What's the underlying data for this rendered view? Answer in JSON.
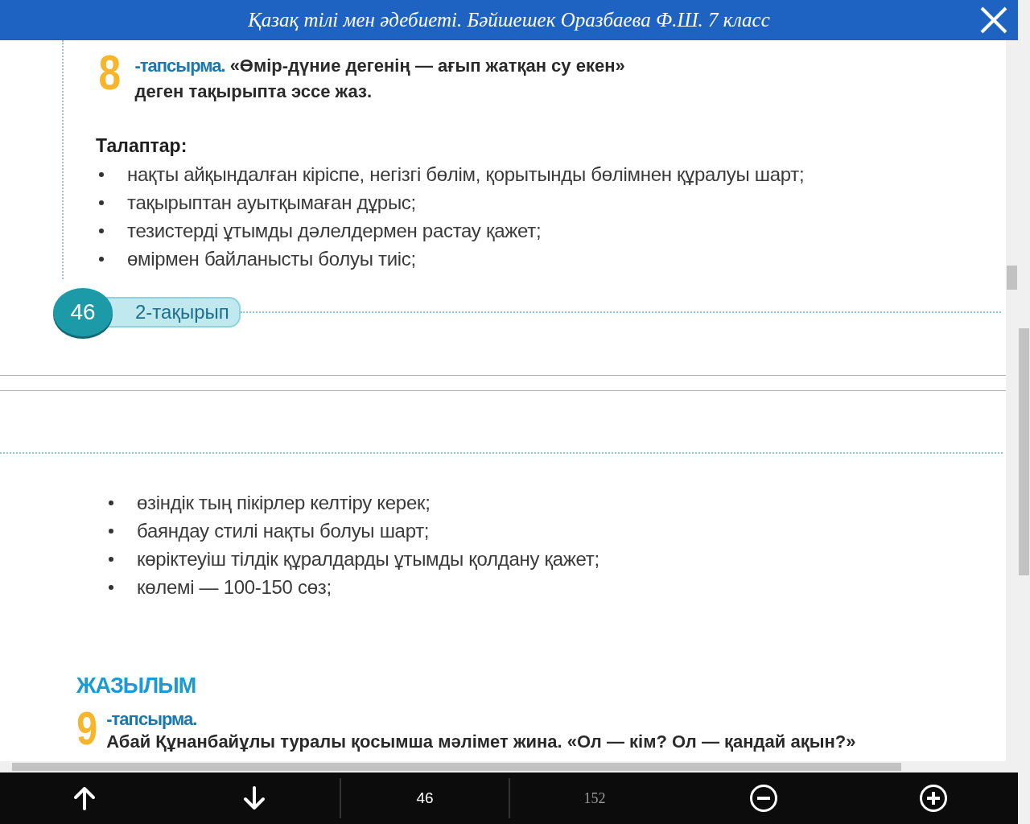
{
  "window": {
    "title": "Қазақ тілі мен әдебиеті. Бәйшешек Оразбаева Ф.Ш. 7 класс"
  },
  "pages": [
    {
      "task": {
        "number": "8",
        "label": "-тапсырма.",
        "lines": [
          "«Өмір-дүние дегенің — ағып жатқан су екен»",
          "деген тақырыпта эссе жаз."
        ]
      },
      "requirements_title": "Талаптар:",
      "bullets": [
        "нақты айқындалған кіріспе, негізгі бөлім, қорытынды бөлімнен құралуы шарт;",
        "тақырыптан ауытқымаған дұрыс;",
        "тезистерді ұтымды дәлелдермен растау қажет;",
        "өмірмен байланысты болуы тиіс;"
      ],
      "footer": {
        "page_number": "46",
        "topic": "2-тақырып"
      }
    },
    {
      "bullets": [
        "өзіндік тың пікірлер келтіру керек;",
        "баяндау стилі нақты болуы шарт;",
        "көріктеуіш тілдік құралдарды ұтымды қолдану қажет;",
        "көлемі — 100-150 сөз;"
      ],
      "section_heading": "ЖАЗЫЛЫМ",
      "task": {
        "number": "9",
        "label": "-тапсырма.",
        "lines": [
          "Абай Құнанбайұлы туралы қосымша мәлімет жина. «Ол — кім? Ол — қандай ақын?»"
        ]
      }
    }
  ],
  "toolbar": {
    "current_page": "46",
    "total_pages": "152"
  }
}
